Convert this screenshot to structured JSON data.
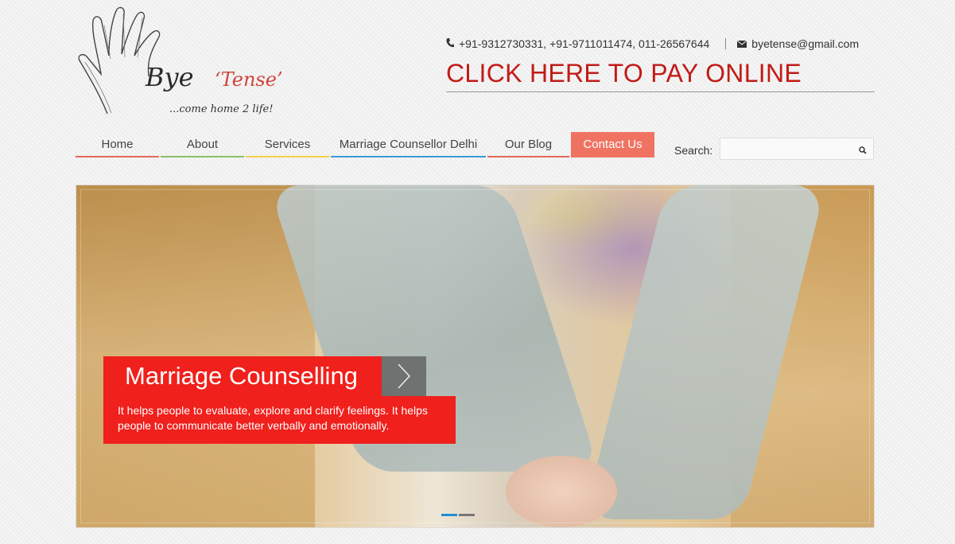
{
  "logo": {
    "brand": "Bye",
    "brand_accent": "‘Tense’",
    "tagline": "...come home 2 life!"
  },
  "contact": {
    "phone": "+91-9312730331, +91-9711011474, 011-26567644",
    "email": "byetense@gmail.com",
    "phone_icon": "phone-icon",
    "email_icon": "envelope-icon"
  },
  "pay_online": "CLICK HERE TO PAY ONLINE",
  "nav": {
    "items": [
      {
        "label": "Home",
        "underline": "#e06a5a"
      },
      {
        "label": "About",
        "underline": "#8dc06a"
      },
      {
        "label": "Services",
        "underline": "#f2d24b"
      },
      {
        "label": "Marriage Counsellor Delhi",
        "underline": "#3a9ad9"
      },
      {
        "label": "Our Blog",
        "underline": "#e06a5a"
      },
      {
        "label": "Contact Us",
        "active": true
      }
    ]
  },
  "search": {
    "label": "Search:",
    "placeholder": "",
    "icon": "search-icon"
  },
  "hero": {
    "title": "Marriage Counselling",
    "text": "It helps people to evaluate, explore and clarify feelings. It helps people to communicate better verbally and emotionally.",
    "slides_total": 2,
    "active_slide": 1
  },
  "colors": {
    "accent_red": "#f0201c",
    "pay_red": "#c21b17",
    "nav_active": "#f07362",
    "slider_active": "#1e8fd6"
  }
}
